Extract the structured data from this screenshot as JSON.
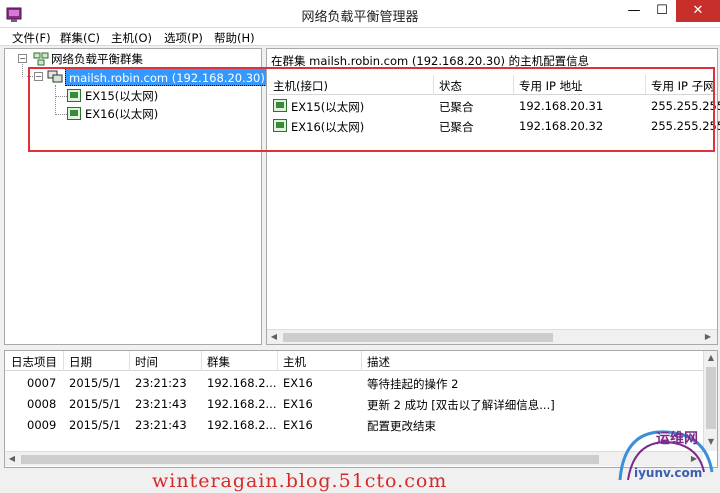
{
  "window": {
    "title": "网络负载平衡管理器",
    "minimize": "—",
    "maximize": "☐",
    "close": "✕",
    "accent": "#c7302a"
  },
  "menu": [
    {
      "label": "文件(F)"
    },
    {
      "label": "群集(C)"
    },
    {
      "label": "主机(O)"
    },
    {
      "label": "选项(P)"
    },
    {
      "label": "帮助(H)"
    }
  ],
  "tree": {
    "root": "网络负载平衡群集",
    "cluster": "mailsh.robin.com (192.168.20.30)",
    "hosts": [
      "EX15(以太网)",
      "EX16(以太网)"
    ],
    "expand": "−",
    "selection_color": "#3399ff"
  },
  "details": {
    "info": "在群集 mailsh.robin.com (192.168.20.30) 的主机配置信息",
    "columns": [
      "主机(接口)",
      "状态",
      "专用 IP 地址",
      "专用 IP 子网"
    ],
    "rows": [
      [
        "EX15(以太网)",
        "已聚合",
        "192.168.20.31",
        "255.255.255"
      ],
      [
        "EX16(以太网)",
        "已聚合",
        "192.168.20.32",
        "255.255.255"
      ]
    ]
  },
  "log": {
    "columns": [
      "日志项目",
      "日期",
      "时间",
      "群集",
      "主机",
      "描述"
    ],
    "rows": [
      [
        "0007",
        "2015/5/1",
        "23:21:23",
        "192.168.2...",
        "EX16",
        "等待挂起的操作 2"
      ],
      [
        "0008",
        "2015/5/1",
        "23:21:43",
        "192.168.2...",
        "EX16",
        "更新 2 成功 [双击以了解详细信息...]"
      ],
      [
        "0009",
        "2015/5/1",
        "23:21:43",
        "192.168.2...",
        "EX16",
        "配置更改结束"
      ]
    ]
  },
  "scroll_arrows": {
    "left": "◀",
    "right": "▶",
    "up": "▲",
    "down": "▼"
  },
  "overlay": {
    "watermark": "winteragain.blog.51cto.com",
    "logo_text": "运维网",
    "logo_domain": "iyunv.com",
    "highlight_color": "#e0303a"
  }
}
